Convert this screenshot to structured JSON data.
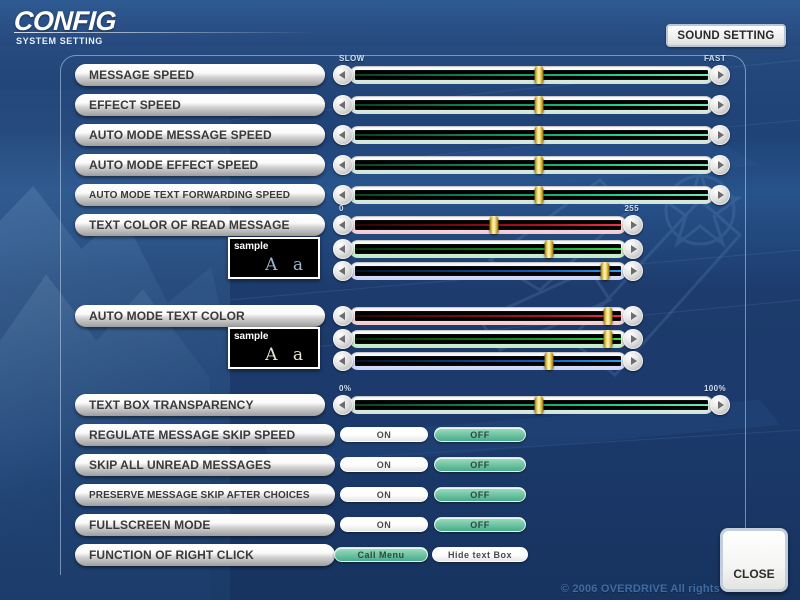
{
  "header": {
    "title": "CONFIG",
    "subtitle": "SYSTEM SETTING",
    "sound_setting_label": "SOUND SETTING"
  },
  "captions": {
    "slow": "SLOW",
    "fast": "FAST",
    "zero": "0",
    "two55": "255",
    "zero_pct": "0%",
    "hundred_pct": "100%"
  },
  "speed_rows": [
    {
      "label": "MESSAGE SPEED",
      "value_pct": 52
    },
    {
      "label": "EFFECT SPEED",
      "value_pct": 52
    },
    {
      "label": "AUTO MODE MESSAGE SPEED",
      "value_pct": 52
    },
    {
      "label": "AUTO MODE EFFECT SPEED",
      "value_pct": 52
    },
    {
      "label": "AUTO MODE TEXT FORWARDING SPEED",
      "value_pct": 52
    }
  ],
  "read_color": {
    "label": "TEXT COLOR OF READ MESSAGE",
    "sample_tag": "sample",
    "sample_glyphs": "A a",
    "r_pct": 52,
    "g_pct": 72,
    "b_pct": 92
  },
  "auto_color": {
    "label": "AUTO MODE TEXT COLOR",
    "sample_tag": "sample",
    "sample_glyphs": "A a",
    "r_pct": 93,
    "g_pct": 93,
    "b_pct": 72
  },
  "transparency": {
    "label": "TEXT BOX TRANSPARENCY",
    "value_pct": 52
  },
  "toggle_rows": [
    {
      "label": "REGULATE MESSAGE SKIP SPEED",
      "opt_a": "ON",
      "opt_b": "OFF",
      "selected": "b",
      "size": "md"
    },
    {
      "label": "SKIP ALL UNREAD MESSAGES",
      "opt_a": "ON",
      "opt_b": "OFF",
      "selected": "b",
      "size": "md"
    },
    {
      "label": "PRESERVE MESSAGE SKIP AFTER CHOICES",
      "opt_a": "ON",
      "opt_b": "OFF",
      "selected": "b",
      "size": "sm"
    },
    {
      "label": "FULLSCREEN MODE",
      "opt_a": "ON",
      "opt_b": "OFF",
      "selected": "b",
      "size": "md"
    },
    {
      "label": "FUNCTION OF RIGHT CLICK",
      "opt_a": "Call Menu",
      "opt_b": "Hide text Box",
      "selected": "a",
      "size": "md"
    }
  ],
  "footer": {
    "close_label": "CLOSE",
    "copyright": "© 2006 OVERDRIVE All rights"
  },
  "colors": {
    "accent_green": "#6dc3a2",
    "panel_white": "#ffffff",
    "knob_gold": "#e8c94f",
    "bg_blue": "#1d3f6e"
  }
}
